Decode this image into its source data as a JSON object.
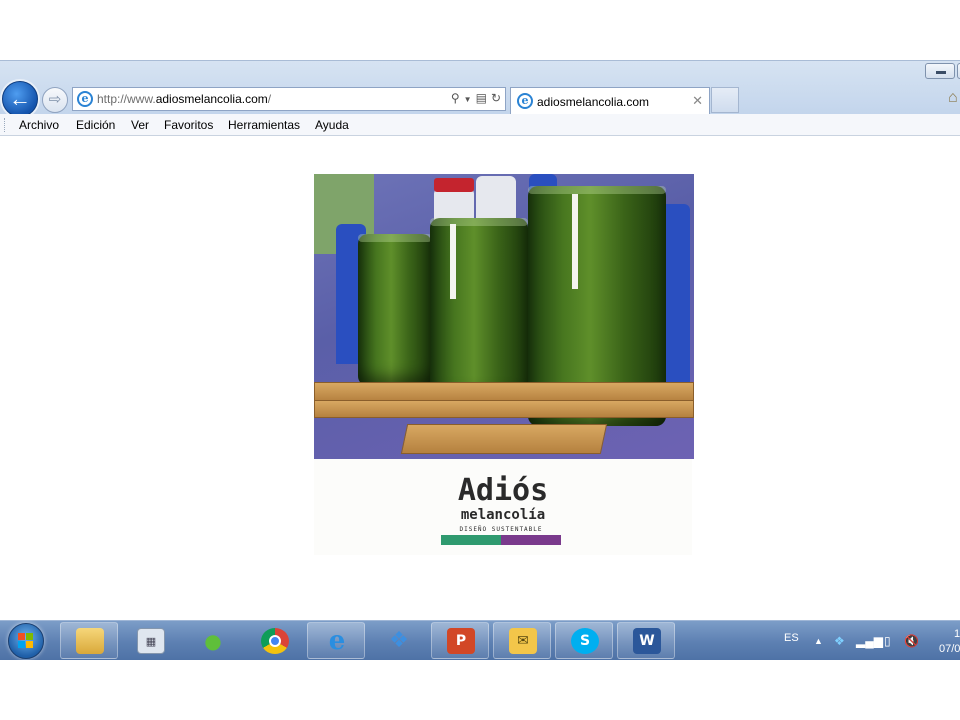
{
  "browser": {
    "url_prefix": "http://www.",
    "url_domain": "adiosmelancolia.com",
    "url_suffix": "/",
    "tab_title": "adiosmelancolia.com"
  },
  "menu": [
    "Archivo",
    "Edición",
    "Ver",
    "Favoritos",
    "Herramientas",
    "Ayuda"
  ],
  "page": {
    "logo_title": "Adiós",
    "logo_subtitle": "melancolía",
    "logo_tagline": "DISEÑO SUSTENTABLE"
  },
  "taskbar": {
    "pinned": [
      "explorer-icon",
      "calculator-icon",
      "messenger-icon",
      "chrome-icon",
      "internet-explorer-icon",
      "dropbox-icon",
      "powerpoint-icon",
      "outlook-icon",
      "skype-icon",
      "word-icon"
    ],
    "language": "ES",
    "clock_time": "1",
    "clock_date": "07/0"
  },
  "colors": {
    "taskbar": "#5d80b2",
    "logo_green": "#2f9a6f",
    "logo_purple": "#7a3a8c"
  }
}
